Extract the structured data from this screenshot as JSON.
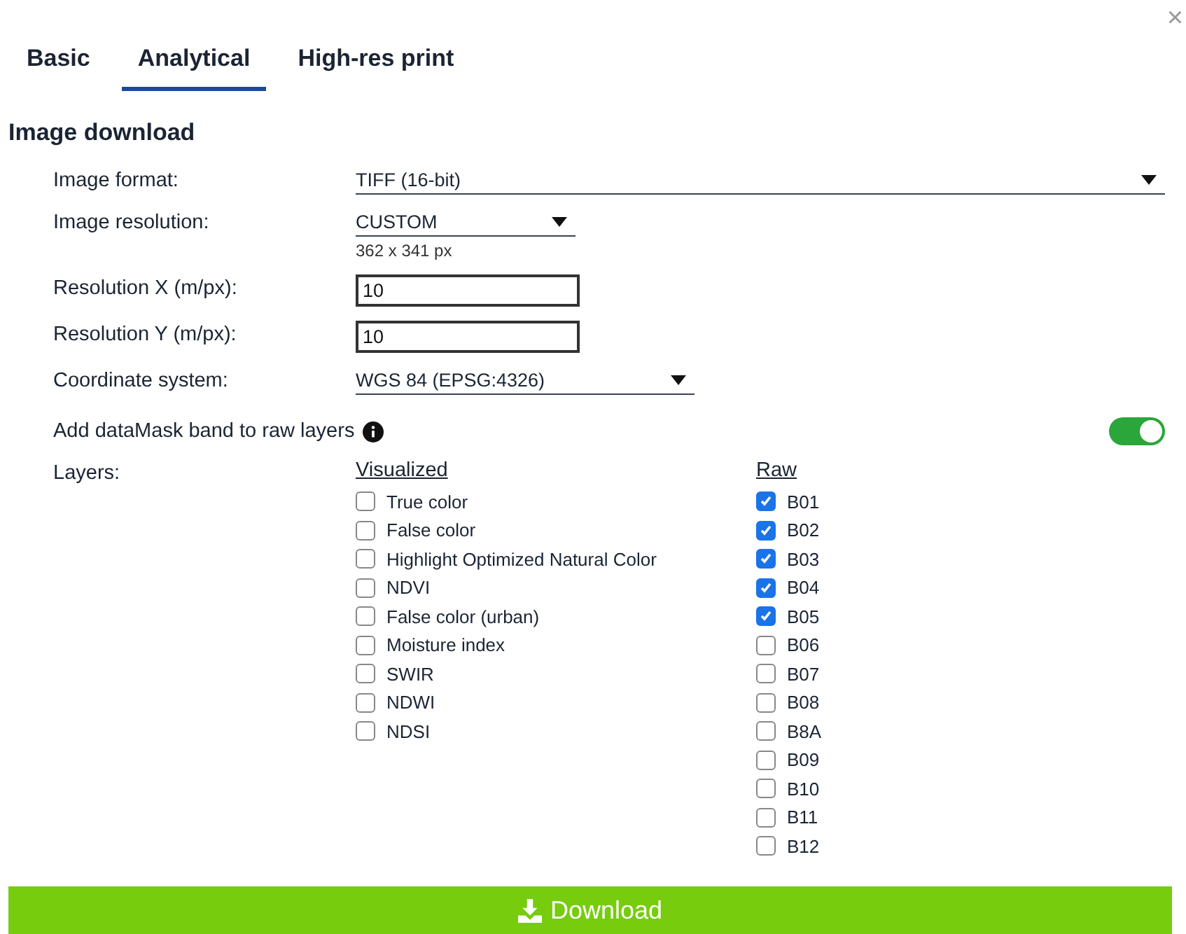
{
  "close": "×",
  "tabs": [
    {
      "label": "Basic",
      "selected": false
    },
    {
      "label": "Analytical",
      "selected": true
    },
    {
      "label": "High-res print",
      "selected": false
    }
  ],
  "section_title": "Image download",
  "fields": [
    {
      "kind": "select",
      "label": "Image format:",
      "value": "TIFF (16-bit)"
    },
    {
      "kind": "select",
      "label": "Image resolution:",
      "value": "CUSTOM",
      "note": "362 x 341 px"
    },
    {
      "kind": "input",
      "label": "Resolution X (m/px):",
      "value": "10"
    },
    {
      "kind": "input",
      "label": "Resolution Y (m/px):",
      "value": "10"
    },
    {
      "kind": "select",
      "label": "Coordinate system:",
      "value": "WGS 84 (EPSG:4326)"
    }
  ],
  "datamask": {
    "label": "Add dataMask band to raw layers",
    "on": true
  },
  "layers": {
    "label": "Layers:",
    "visualized": {
      "title": "Visualized",
      "items": [
        {
          "label": "True color",
          "checked": false
        },
        {
          "label": "False color",
          "checked": false
        },
        {
          "label": "Highlight Optimized Natural Color",
          "checked": false
        },
        {
          "label": "NDVI",
          "checked": false
        },
        {
          "label": "False color (urban)",
          "checked": false
        },
        {
          "label": "Moisture index",
          "checked": false
        },
        {
          "label": "SWIR",
          "checked": false
        },
        {
          "label": "NDWI",
          "checked": false
        },
        {
          "label": "NDSI",
          "checked": false
        }
      ]
    },
    "raw": {
      "title": "Raw",
      "items": [
        {
          "label": "B01",
          "checked": true
        },
        {
          "label": "B02",
          "checked": true
        },
        {
          "label": "B03",
          "checked": true
        },
        {
          "label": "B04",
          "checked": true
        },
        {
          "label": "B05",
          "checked": true
        },
        {
          "label": "B06",
          "checked": false
        },
        {
          "label": "B07",
          "checked": false
        },
        {
          "label": "B08",
          "checked": false
        },
        {
          "label": "B8A",
          "checked": false
        },
        {
          "label": "B09",
          "checked": false
        },
        {
          "label": "B10",
          "checked": false
        },
        {
          "label": "B11",
          "checked": false
        },
        {
          "label": "B12",
          "checked": false
        }
      ]
    }
  },
  "download_button": "Download"
}
